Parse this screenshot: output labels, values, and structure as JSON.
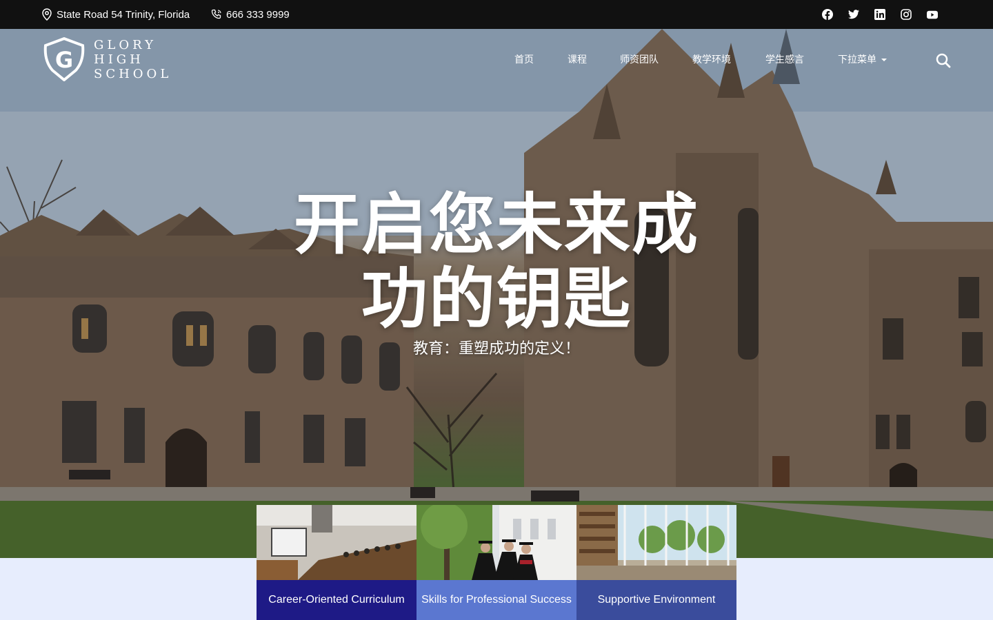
{
  "topbar": {
    "address": "State Road 54 Trinity, Florida",
    "phone": "666 333 9999",
    "social_icons": [
      "facebook-icon",
      "twitter-icon",
      "linkedin-icon",
      "instagram-icon",
      "youtube-icon"
    ]
  },
  "brand": {
    "letter": "G",
    "line1": "GLORY",
    "line2": "HIGH",
    "line3": "SCHOOL"
  },
  "nav": {
    "items": [
      {
        "label": "首页"
      },
      {
        "label": "课程"
      },
      {
        "label": "师资团队"
      },
      {
        "label": "教学环境"
      },
      {
        "label": "学生感言"
      },
      {
        "label": "下拉菜单"
      }
    ],
    "search_icon": "search-icon"
  },
  "hero": {
    "title_line1": "开启您未来成",
    "title_line2": "功的钥匙",
    "subtitle": "教育：重塑成功的定义！"
  },
  "features": [
    {
      "label": "Career-Oriented Curriculum",
      "color": "#1e1a86"
    },
    {
      "label": "Skills for Professional Success",
      "color": "#5b77d0"
    },
    {
      "label": "Supportive Environment",
      "color": "#3a4c9c"
    }
  ],
  "colors": {
    "topbar": "#111111",
    "page_bg": "#e7edfd"
  }
}
